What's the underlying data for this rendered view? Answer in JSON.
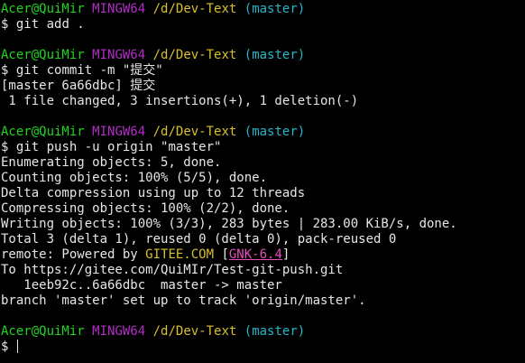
{
  "prompt": {
    "user_host": "Acer@QuiMir",
    "msys": "MINGW64",
    "path": "/d/Dev-Text",
    "branch": "(master)",
    "symbol": "$"
  },
  "blocks": [
    {
      "command": "git add .",
      "output": []
    },
    {
      "command": "git commit -m \"提交\"",
      "output": [
        "[master 6a66dbc] 提交",
        " 1 file changed, 3 insertions(+), 1 deletion(-)"
      ]
    },
    {
      "command": "git push -u origin \"master\"",
      "output": [
        "Enumerating objects: 5, done.",
        "Counting objects: 100% (5/5), done.",
        "Delta compression using up to 12 threads",
        "Compressing objects: 100% (2/2), done.",
        "Writing objects: 100% (3/3), 283 bytes | 283.00 KiB/s, done.",
        "Total 3 (delta 1), reused 0 (delta 0), pack-reused 0"
      ],
      "remote": {
        "prefix": "remote: Powered by ",
        "site": "GITEE.COM",
        "open_bracket": " [",
        "tag": "GNK-6.4",
        "close_bracket": "]"
      },
      "output_after": [
        "To https://gitee.com/QuiMIr/Test-git-push.git",
        "   1eeb92c..6a66dbc  master -> master",
        "branch 'master' set up to track 'origin/master'."
      ]
    }
  ],
  "colors": {
    "background": "#000000",
    "text": "#e6e6e6",
    "user": "#1fd51f",
    "host": "#b32cc7",
    "path": "#d8c02c",
    "branch": "#25b6c9",
    "gnk": "#e44fb9"
  }
}
